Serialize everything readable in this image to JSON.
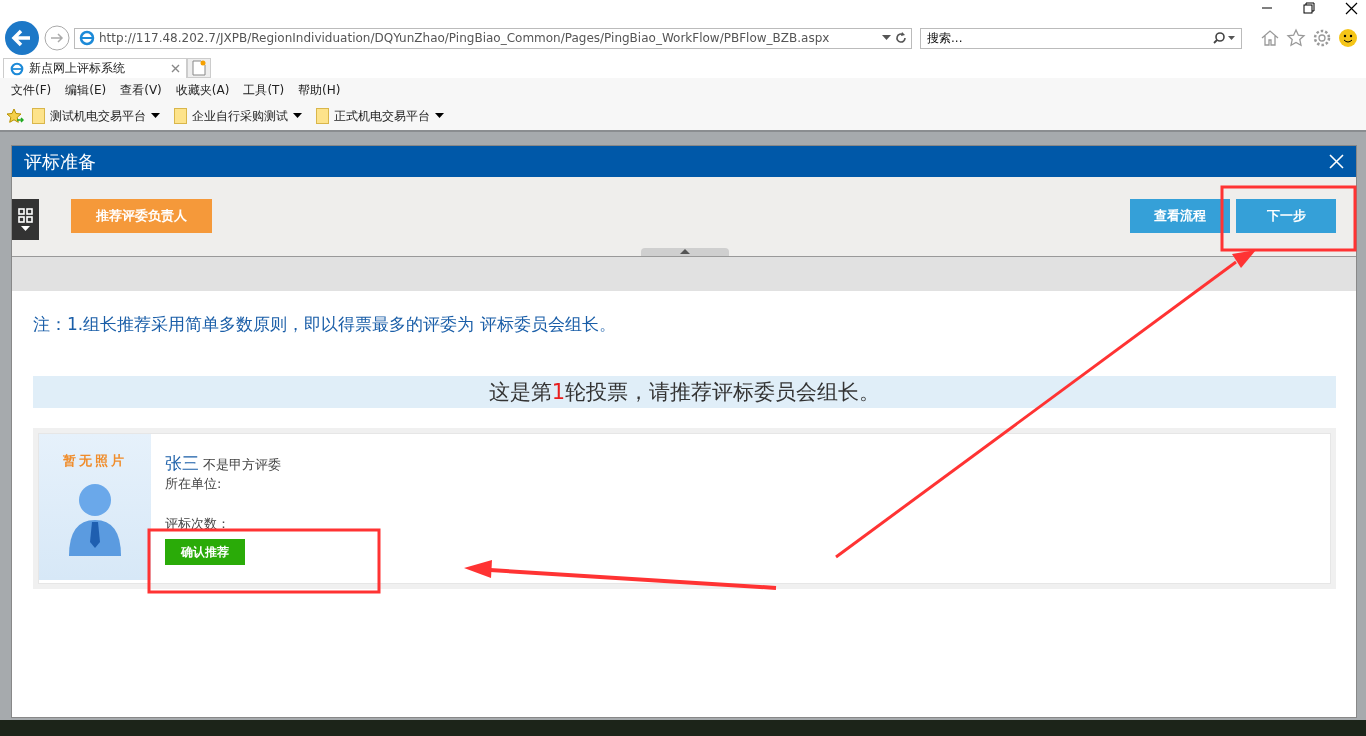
{
  "browser": {
    "address": "http://117.48.202.7/JXPB/RegionIndividuation/DQYunZhao/PingBiao_Common/Pages/PingBiao_WorkFlow/PBFlow_BZB.aspx",
    "search_placeholder": "搜索...",
    "tab": {
      "title": "新点网上评标系统"
    },
    "menu": [
      "文件(F)",
      "编辑(E)",
      "查看(V)",
      "收藏夹(A)",
      "工具(T)",
      "帮助(H)"
    ],
    "favorites": [
      "测试机电交易平台",
      "企业自行采购测试",
      "正式机电交易平台"
    ]
  },
  "dialog": {
    "title": "评标准备",
    "left_buttons": [
      {
        "label": "推荐评委负责人",
        "kind": "orange"
      }
    ],
    "right_buttons": [
      {
        "label": "查看流程",
        "kind": "blue"
      },
      {
        "label": "下一步",
        "kind": "blue"
      }
    ],
    "note": "注：1.组长推荐采用简单多数原则，即以得票最多的评委为 评标委员会组长。",
    "banner": {
      "prefix": "这是第",
      "round": "1",
      "suffix": "轮投票，请推荐评标委员会组长。"
    },
    "candidates": [
      {
        "photo_text": "暂无照片",
        "name": "张三",
        "tag": "不是甲方评委",
        "unit_label": "所在单位:",
        "count_label": "评标次数：",
        "button": "确认推荐"
      }
    ]
  }
}
